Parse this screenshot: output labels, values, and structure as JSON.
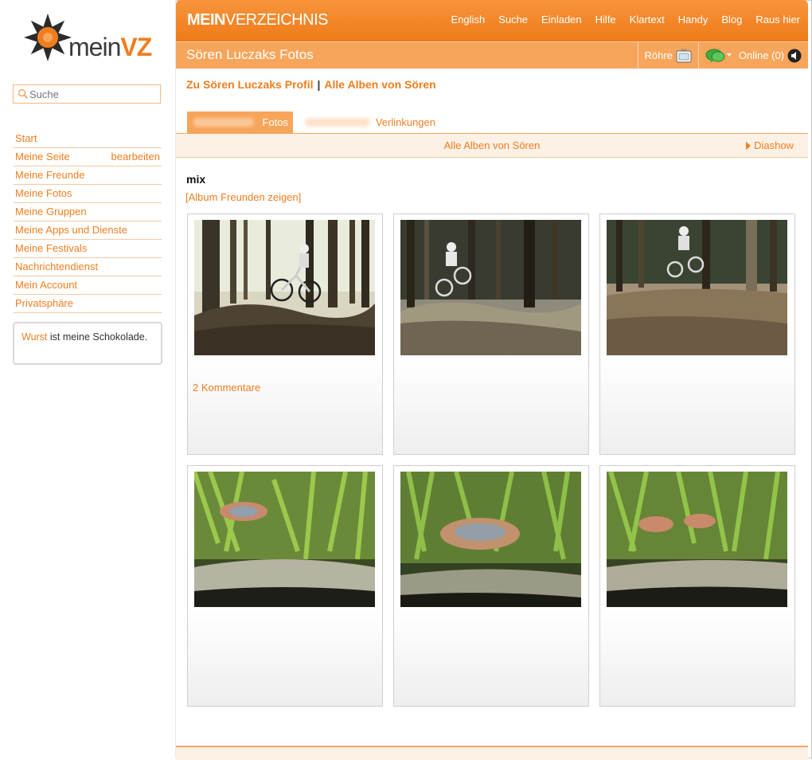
{
  "logo": {
    "prefix": "mein",
    "suffix": "VZ"
  },
  "search": {
    "placeholder": "Suche"
  },
  "sidebar": {
    "items": [
      {
        "label": "Start"
      },
      {
        "label": "Meine Seite",
        "extra": "bearbeiten"
      },
      {
        "label": "Meine Freunde"
      },
      {
        "label": "Meine Fotos"
      },
      {
        "label": "Meine Gruppen"
      },
      {
        "label": "Meine Apps und Dienste"
      },
      {
        "label": "Meine Festivals"
      },
      {
        "label": "Nachrichtendienst"
      },
      {
        "label": "Mein Account"
      },
      {
        "label": "Privatsphäre"
      }
    ],
    "status": {
      "who": "Wurst",
      "text": " ist meine Schokolade."
    }
  },
  "header": {
    "brand_bold": "MEIN",
    "brand_rest": "VERZEICHNIS",
    "nav": [
      "English",
      "Suche",
      "Einladen",
      "Hilfe",
      "Klartext",
      "Handy",
      "Blog",
      "Raus hier"
    ]
  },
  "subheader": {
    "title": "Sören Luczaks Fotos",
    "tv_label": "Röhre",
    "online_label": "Online (0)"
  },
  "breadcrumbs": {
    "profile": "Zu Sören Luczaks Profil",
    "separator": "|",
    "albums": "Alle Alben von Sören"
  },
  "tabs": {
    "photos": "Fotos",
    "links": "Verlinkungen"
  },
  "albumbar": {
    "all_albums": "Alle Alben von Sören",
    "slideshow": "Diashow"
  },
  "album": {
    "title": "mix",
    "share_link": "[Album Freunden zeigen]",
    "photos": [
      {
        "kind": "bike",
        "comments": "2 Kommentare"
      },
      {
        "kind": "bike",
        "comments": ""
      },
      {
        "kind": "bike",
        "comments": ""
      },
      {
        "kind": "fish",
        "comments": ""
      },
      {
        "kind": "fish",
        "comments": ""
      },
      {
        "kind": "fish",
        "comments": ""
      }
    ]
  },
  "colors": {
    "accent": "#f07d1e",
    "bar": "#f7a55b"
  }
}
